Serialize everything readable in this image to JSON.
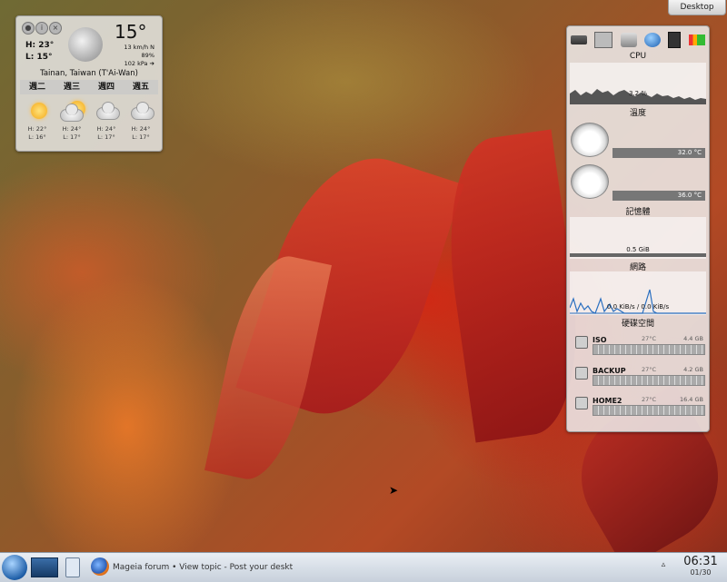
{
  "desktop_button": "Desktop",
  "weather": {
    "temperature": "15°",
    "high": "H: 23°",
    "low": "L: 15°",
    "wind": "13 km/h N",
    "humidity": "89%",
    "pressure": "102 kPa ➔",
    "location": "Tainan, Taiwan (T'Ai-Wan)",
    "days": [
      "週二",
      "週三",
      "週四",
      "週五"
    ],
    "forecast": [
      {
        "hi": "H: 22°",
        "lo": "L: 16°",
        "icon": "sun-icon"
      },
      {
        "hi": "H: 24°",
        "lo": "L: 17°",
        "icon": "partly-cloudy-icon"
      },
      {
        "hi": "H: 24°",
        "lo": "L: 17°",
        "icon": "cloud-icon"
      },
      {
        "hi": "H: 24°",
        "lo": "L: 17°",
        "icon": "cloud-icon"
      }
    ]
  },
  "sysmon": {
    "cpu_title": "CPU",
    "cpu_value": "3.2 %",
    "temp_title": "溫度",
    "temp1": "32.0 °C",
    "temp2": "36.0 °C",
    "mem_title": "記憶體",
    "mem_value": "0.5 GiB",
    "net_title": "網路",
    "net_value": "0.0 KiB/s / 0.0 KiB/s",
    "disk_title": "硬碟空間",
    "disks": [
      {
        "name": "ISO",
        "temp": "27°C",
        "size": "4.4 GB",
        "used": 0.85
      },
      {
        "name": "BACKUP",
        "temp": "27°C",
        "size": "4.2 GB",
        "used": 0.82
      },
      {
        "name": "HOME2",
        "temp": "27°C",
        "size": "16.4 GB",
        "used": 0.55
      }
    ]
  },
  "taskbar": {
    "task_title": "Mageia forum • View topic - Post your deskt",
    "time": "06:31",
    "date": "01/30"
  },
  "colors": {
    "cpu_graph": "#555555",
    "net_graph": "#2a6fc0",
    "signal": "#3cb43c"
  }
}
